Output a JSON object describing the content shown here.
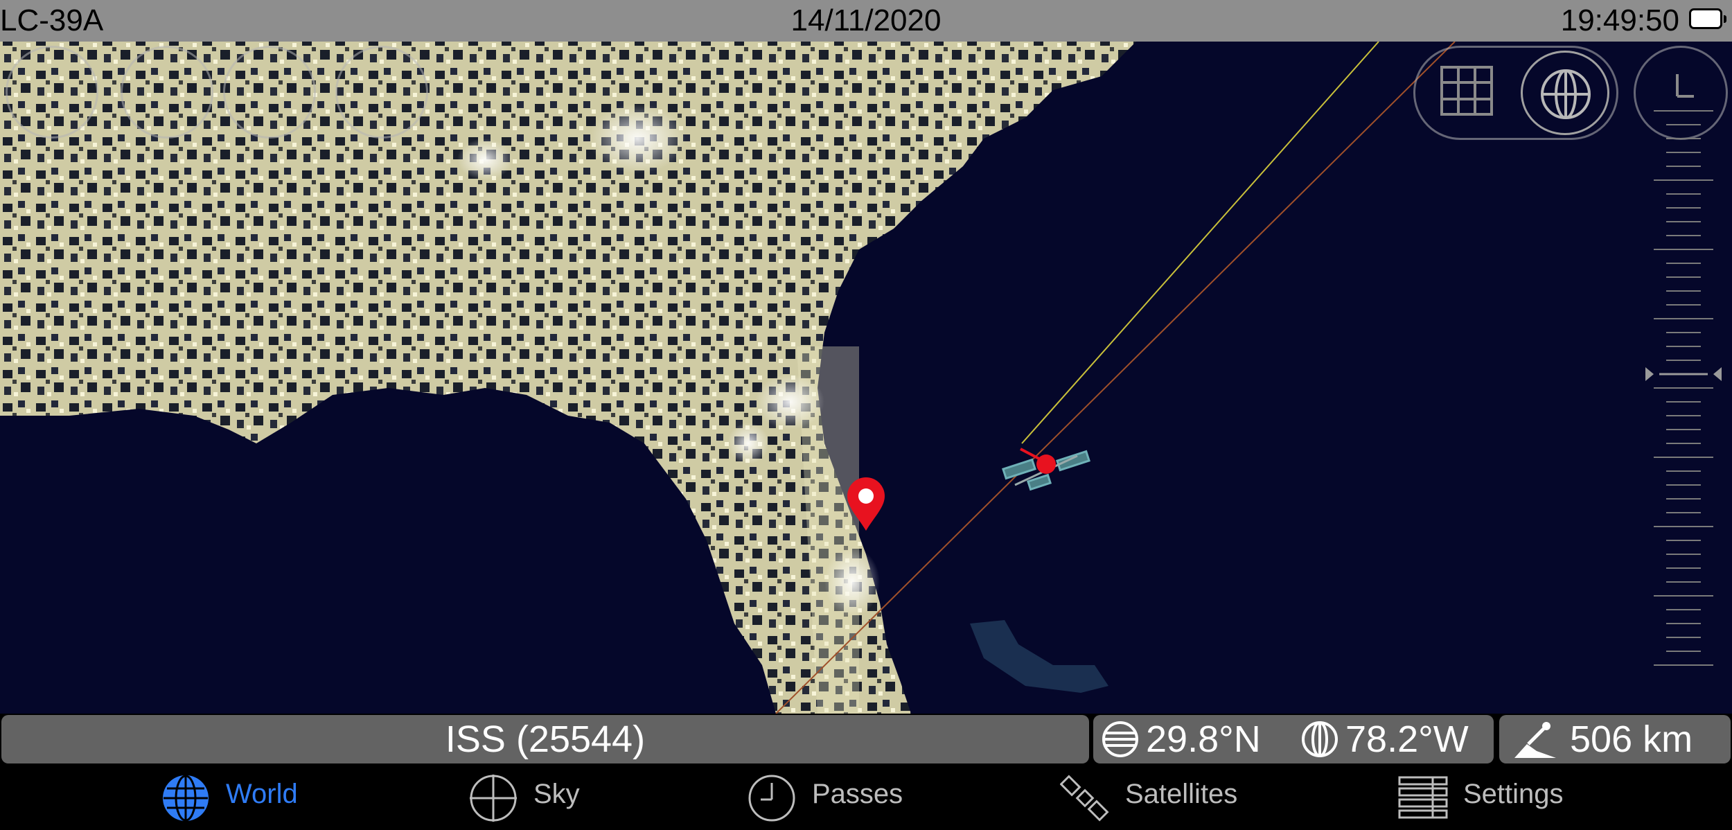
{
  "status_bar": {
    "location": "LC-39A",
    "date": "14/11/2020",
    "time": "19:49:50",
    "battery_icon": "battery-full-icon"
  },
  "map": {
    "view": "night-lights-earth",
    "map_mode_buttons": [
      "grid-icon",
      "globe-icon"
    ],
    "top_left_controls": [
      "orientation-icon",
      "location-pin-icon",
      "no-location-icon",
      "pin-icon"
    ],
    "clock_button": "clock-icon",
    "marker_icon": "location-pin-icon",
    "satellite_icon": "iss-icon",
    "colors": {
      "ocean": "#05072a",
      "lights": "#f4f0c8",
      "orbit_future": "#c9c03a",
      "orbit_past": "#a0502a",
      "marker": "#e8121f"
    }
  },
  "info": {
    "satellite": "ISS (25544)",
    "latitude": "29.8°N",
    "longitude": "78.2°W",
    "altitude": "506 km"
  },
  "tabs": [
    {
      "label": "World",
      "icon": "globe-icon",
      "active": true
    },
    {
      "label": "Sky",
      "icon": "crosshair-icon",
      "active": false
    },
    {
      "label": "Passes",
      "icon": "clock-icon",
      "active": false
    },
    {
      "label": "Satellites",
      "icon": "satellite-icon",
      "active": false
    },
    {
      "label": "Settings",
      "icon": "settings-list-icon",
      "active": false
    }
  ],
  "accent_color": "#2f7cf6"
}
